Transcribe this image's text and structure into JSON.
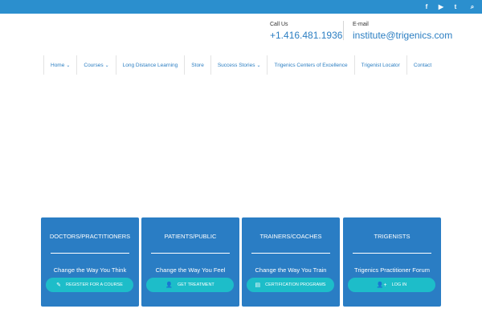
{
  "social": [
    {
      "icon": "facebook-icon",
      "glyph": "f"
    },
    {
      "icon": "youtube-icon",
      "glyph": "▶"
    },
    {
      "icon": "twitter-icon",
      "glyph": "t"
    },
    {
      "icon": "search-icon",
      "glyph": "⌕"
    }
  ],
  "contact": {
    "call_label": "Call Us",
    "phone": "+1.416.481.1936",
    "email_label": "E-mail",
    "email": "institute@trigenics.com"
  },
  "nav": [
    {
      "label": "Home",
      "dropdown": true
    },
    {
      "label": "Courses",
      "dropdown": true
    },
    {
      "label": "Long Distance Learning",
      "dropdown": false
    },
    {
      "label": "Store",
      "dropdown": false
    },
    {
      "label": "Success Stories",
      "dropdown": true
    },
    {
      "label": "Trigenics Centers of Excellence",
      "dropdown": false
    },
    {
      "label": "Trigenist Locator",
      "dropdown": false
    },
    {
      "label": "Contact",
      "dropdown": false
    }
  ],
  "cards": [
    {
      "title": "DOCTORS/PRACTITIONERS",
      "tagline": "Change the Way You Think",
      "button": "REGISTER FOR A COURSE",
      "button_icon": "pencil-icon",
      "glyph": "✎"
    },
    {
      "title": "PATIENTS/PUBLIC",
      "tagline": "Change the Way You Feel",
      "button": "GET TREATMENT",
      "button_icon": "user-icon",
      "glyph": "👤"
    },
    {
      "title": "TRAINERS/COACHES",
      "tagline": "Change the Way You Train",
      "button": "CERTIFICATION PROGRAMS",
      "button_icon": "book-icon",
      "glyph": "▤"
    },
    {
      "title": "TRIGENISTS",
      "tagline": "Trigenics Practitioner Forum",
      "button": "LOG IN",
      "button_icon": "user-plus-icon",
      "glyph": "👤+"
    }
  ],
  "colors": {
    "topbar": "#2b8fce",
    "accent": "#2b7ec2",
    "card": "#2a7dc4",
    "button": "#1dbdc9"
  }
}
